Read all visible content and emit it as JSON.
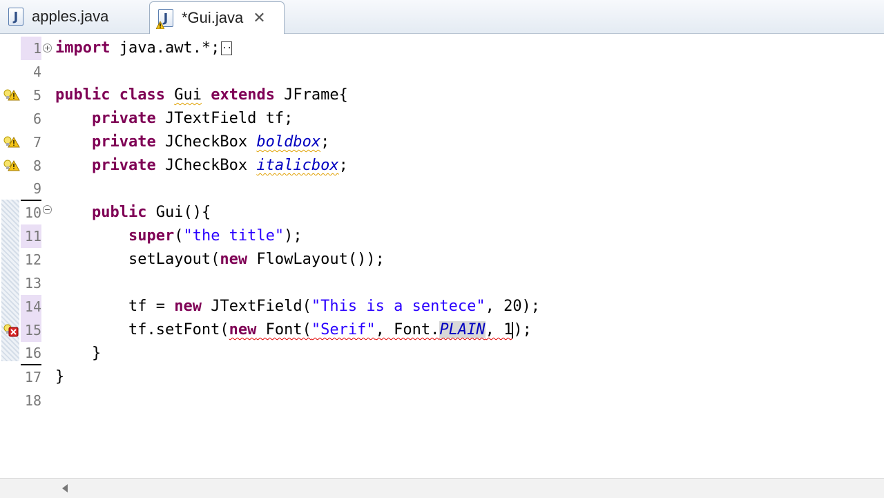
{
  "tabs": [
    {
      "label": "apples.java",
      "icon": "java-file-icon",
      "active": false
    },
    {
      "label": "*Gui.java",
      "icon": "java-file-warning-icon",
      "active": true,
      "close": "✕"
    }
  ],
  "colors": {
    "keyword": "#7f0055",
    "string": "#2a00ff",
    "constant": "#0000c0",
    "line_number": "#787878",
    "change_bar": "#eadff5"
  },
  "editor": {
    "lines": [
      {
        "num": "1"
      },
      {
        "num": "4"
      },
      {
        "num": "5"
      },
      {
        "num": "6"
      },
      {
        "num": "7"
      },
      {
        "num": "8"
      },
      {
        "num": "9"
      },
      {
        "num": "10"
      },
      {
        "num": "11"
      },
      {
        "num": "12"
      },
      {
        "num": "13"
      },
      {
        "num": "14"
      },
      {
        "num": "15"
      },
      {
        "num": "16"
      },
      {
        "num": "17"
      },
      {
        "num": "18"
      }
    ],
    "code": {
      "l1_import": "import",
      "l1_rest": " java.awt.*;",
      "l1_box": "..",
      "l5_public": "public",
      "l5_class": "class",
      "l5_name": "Gui",
      "l5_extends": "extends",
      "l5_rest": " JFrame{",
      "l6_private": "private",
      "l6_rest": " JTextField tf;",
      "l7_private": "private",
      "l7_type": " JCheckBox ",
      "l7_var": "boldbox",
      "l7_end": ";",
      "l8_private": "private",
      "l8_type": " JCheckBox ",
      "l8_var": "italicbox",
      "l8_end": ";",
      "l10_public": "public",
      "l10_rest": " Gui(){",
      "l11_super": "super",
      "l11_open": "(",
      "l11_str": "\"the title\"",
      "l11_close": ");",
      "l12_a": "setLayout(",
      "l12_new": "new",
      "l12_b": " FlowLayout());",
      "l14_a": "tf = ",
      "l14_new": "new",
      "l14_b": " JTextField(",
      "l14_str": "\"This is a sentece\"",
      "l14_c": ", 20);",
      "l15_a": "tf.setFont(",
      "l15_new": "new",
      "l15_b": " Font(",
      "l15_str": "\"Serif\"",
      "l15_c": ", Font.",
      "l15_const": "PLAIN",
      "l15_d": ", 1",
      "l15_e": ");",
      "l16": "}",
      "l17": "}"
    }
  }
}
